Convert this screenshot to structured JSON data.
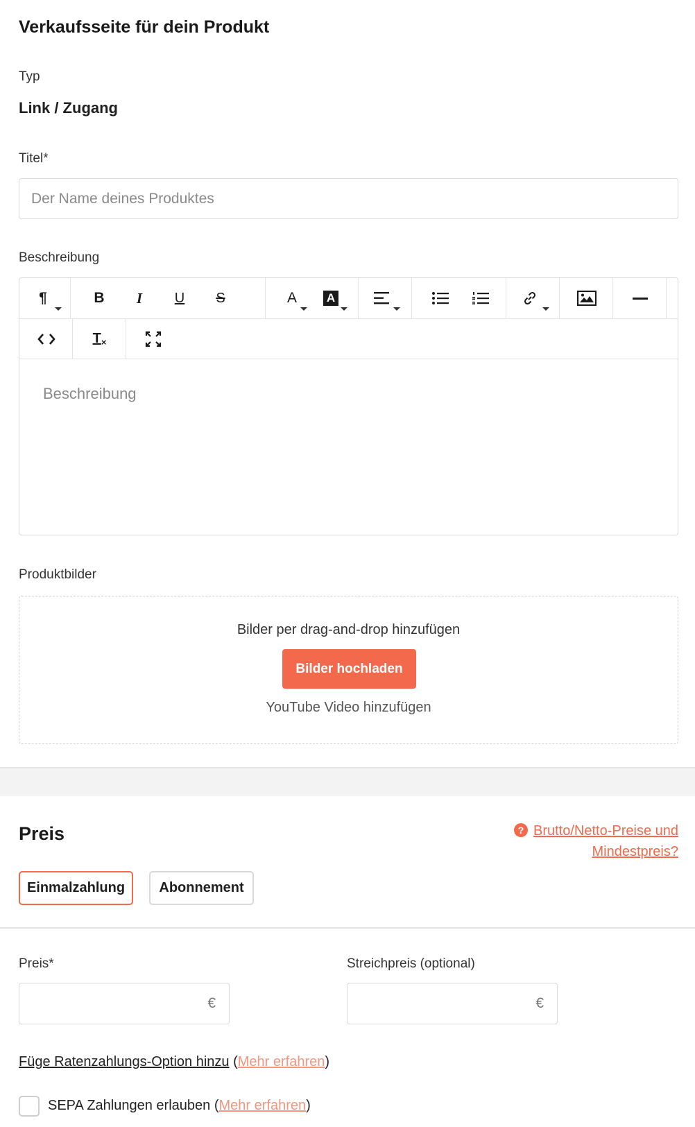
{
  "page": {
    "title": "Verkaufsseite für dein Produkt"
  },
  "type_field": {
    "label": "Typ",
    "value": "Link / Zugang"
  },
  "title_field": {
    "label": "Titel*",
    "placeholder": "Der Name deines Produktes"
  },
  "description_field": {
    "label": "Beschreibung",
    "placeholder": "Beschreibung"
  },
  "editor_toolbar": [
    "paragraph-format-icon",
    "bold-icon",
    "italic-icon",
    "underline-icon",
    "strikethrough-icon",
    "text-color-icon",
    "background-color-icon",
    "align-icon",
    "unordered-list-icon",
    "ordered-list-icon",
    "link-icon",
    "image-icon",
    "horizontal-rule-icon",
    "code-view-icon",
    "clear-formatting-icon",
    "fullscreen-icon"
  ],
  "images_field": {
    "label": "Produktbilder",
    "dropzone_text": "Bilder per drag-and-drop hinzufügen",
    "upload_button": "Bilder hochladen",
    "youtube_link": "YouTube Video hinzufügen"
  },
  "price_section": {
    "heading": "Preis",
    "help_link_line1": "Brutto/Netto-Preise und",
    "help_link_line2": "Mindestpreis?",
    "help_icon_glyph": "?",
    "tabs": [
      "Einmalzahlung",
      "Abonnement"
    ],
    "active_tab": "Einmalzahlung",
    "price_label": "Preis*",
    "strike_price_label": "Streichpreis (optional)",
    "currency_symbol": "€",
    "installment_text": "Füge Ratenzahlungs-Option hinzu",
    "learn_more": "Mehr erfahren",
    "sepa_text": "SEPA Zahlungen erlauben",
    "sepa_checked": false
  },
  "colors": {
    "accent": "#f26a4b",
    "accent_link": "#f4957d",
    "border": "#d9d9d9",
    "section_bg": "#f3f3f3"
  }
}
